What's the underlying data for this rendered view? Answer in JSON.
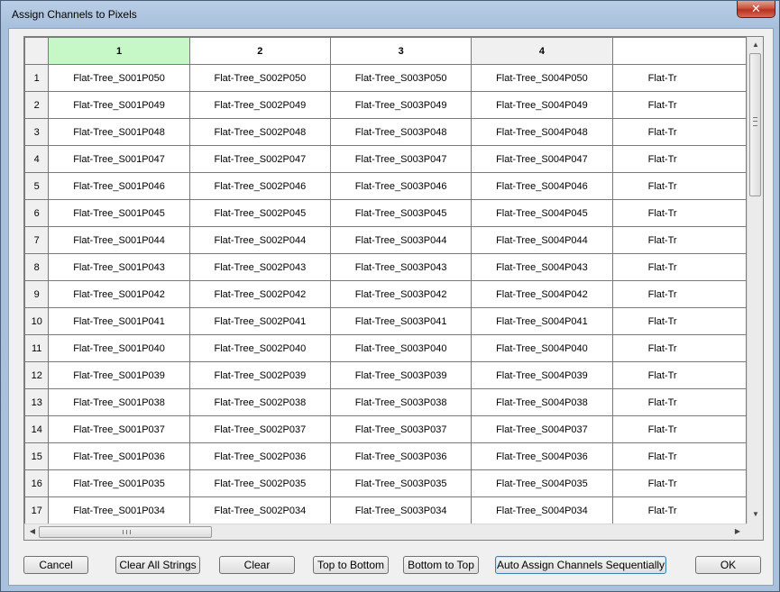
{
  "window": {
    "title": "Assign Channels to Pixels",
    "close_label": "✕"
  },
  "grid": {
    "columns": [
      "1",
      "2",
      "3",
      "4",
      ""
    ],
    "rows": [
      {
        "num": "1",
        "cells": [
          "Flat-Tree_S001P050",
          "Flat-Tree_S002P050",
          "Flat-Tree_S003P050",
          "Flat-Tree_S004P050",
          "Flat-Tr"
        ]
      },
      {
        "num": "2",
        "cells": [
          "Flat-Tree_S001P049",
          "Flat-Tree_S002P049",
          "Flat-Tree_S003P049",
          "Flat-Tree_S004P049",
          "Flat-Tr"
        ]
      },
      {
        "num": "3",
        "cells": [
          "Flat-Tree_S001P048",
          "Flat-Tree_S002P048",
          "Flat-Tree_S003P048",
          "Flat-Tree_S004P048",
          "Flat-Tr"
        ]
      },
      {
        "num": "4",
        "cells": [
          "Flat-Tree_S001P047",
          "Flat-Tree_S002P047",
          "Flat-Tree_S003P047",
          "Flat-Tree_S004P047",
          "Flat-Tr"
        ]
      },
      {
        "num": "5",
        "cells": [
          "Flat-Tree_S001P046",
          "Flat-Tree_S002P046",
          "Flat-Tree_S003P046",
          "Flat-Tree_S004P046",
          "Flat-Tr"
        ]
      },
      {
        "num": "6",
        "cells": [
          "Flat-Tree_S001P045",
          "Flat-Tree_S002P045",
          "Flat-Tree_S003P045",
          "Flat-Tree_S004P045",
          "Flat-Tr"
        ]
      },
      {
        "num": "7",
        "cells": [
          "Flat-Tree_S001P044",
          "Flat-Tree_S002P044",
          "Flat-Tree_S003P044",
          "Flat-Tree_S004P044",
          "Flat-Tr"
        ]
      },
      {
        "num": "8",
        "cells": [
          "Flat-Tree_S001P043",
          "Flat-Tree_S002P043",
          "Flat-Tree_S003P043",
          "Flat-Tree_S004P043",
          "Flat-Tr"
        ]
      },
      {
        "num": "9",
        "cells": [
          "Flat-Tree_S001P042",
          "Flat-Tree_S002P042",
          "Flat-Tree_S003P042",
          "Flat-Tree_S004P042",
          "Flat-Tr"
        ]
      },
      {
        "num": "10",
        "cells": [
          "Flat-Tree_S001P041",
          "Flat-Tree_S002P041",
          "Flat-Tree_S003P041",
          "Flat-Tree_S004P041",
          "Flat-Tr"
        ]
      },
      {
        "num": "11",
        "cells": [
          "Flat-Tree_S001P040",
          "Flat-Tree_S002P040",
          "Flat-Tree_S003P040",
          "Flat-Tree_S004P040",
          "Flat-Tr"
        ]
      },
      {
        "num": "12",
        "cells": [
          "Flat-Tree_S001P039",
          "Flat-Tree_S002P039",
          "Flat-Tree_S003P039",
          "Flat-Tree_S004P039",
          "Flat-Tr"
        ]
      },
      {
        "num": "13",
        "cells": [
          "Flat-Tree_S001P038",
          "Flat-Tree_S002P038",
          "Flat-Tree_S003P038",
          "Flat-Tree_S004P038",
          "Flat-Tr"
        ]
      },
      {
        "num": "14",
        "cells": [
          "Flat-Tree_S001P037",
          "Flat-Tree_S002P037",
          "Flat-Tree_S003P037",
          "Flat-Tree_S004P037",
          "Flat-Tr"
        ]
      },
      {
        "num": "15",
        "cells": [
          "Flat-Tree_S001P036",
          "Flat-Tree_S002P036",
          "Flat-Tree_S003P036",
          "Flat-Tree_S004P036",
          "Flat-Tr"
        ]
      },
      {
        "num": "16",
        "cells": [
          "Flat-Tree_S001P035",
          "Flat-Tree_S002P035",
          "Flat-Tree_S003P035",
          "Flat-Tree_S004P035",
          "Flat-Tr"
        ]
      },
      {
        "num": "17",
        "cells": [
          "Flat-Tree_S001P034",
          "Flat-Tree_S002P034",
          "Flat-Tree_S003P034",
          "Flat-Tree_S004P034",
          "Flat-Tr"
        ]
      }
    ],
    "selected_column_color": "#c6f7c6"
  },
  "scroll": {
    "up": "▲",
    "down": "▼",
    "left": "◀",
    "right": "▶"
  },
  "buttons": {
    "cancel": "Cancel",
    "clear_all_strings": "Clear All Strings",
    "clear": "Clear",
    "top_to_bottom": "Top to Bottom",
    "bottom_to_top": "Bottom to Top",
    "auto_assign": "Auto Assign Channels Sequentially",
    "ok": "OK"
  }
}
